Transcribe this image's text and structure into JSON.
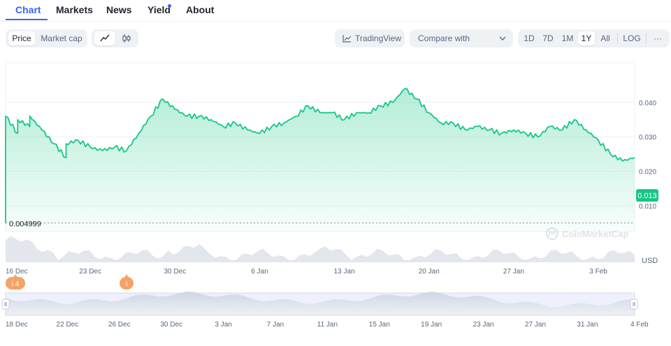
{
  "tabs": [
    {
      "label": "Chart",
      "active": true
    },
    {
      "label": "Markets"
    },
    {
      "label": "News"
    },
    {
      "label": "Yield",
      "has_dot": true
    },
    {
      "label": "About"
    }
  ],
  "toolbar": {
    "price_label": "Price",
    "market_cap_label": "Market cap",
    "line_icon": "line-chart-icon",
    "candle_icon": "candlestick-icon",
    "tradingview_label": "TradingView",
    "compare_label": "Compare with",
    "ranges": [
      "1D",
      "7D",
      "1M",
      "1Y",
      "All"
    ],
    "selected_range": "1Y",
    "log_label": "LOG",
    "more_label": "···"
  },
  "colors": {
    "accent": "#3861fb",
    "line": "#16c784",
    "fill": "#16c784",
    "marker": "#f5a266"
  },
  "chart_data": {
    "type": "area",
    "y_ticks": [
      "0.040",
      "0.030",
      "0.020",
      "0.010"
    ],
    "ylim": [
      0.0025,
      0.0515
    ],
    "currency": "USD",
    "current_price_label": "0.013",
    "low_label": "0.004999",
    "x_tick_labels": [
      "16 Dec",
      "23 Dec",
      "30 Dec",
      "6 Jan",
      "13 Jan",
      "20 Jan",
      "27 Jan",
      "3 Feb"
    ],
    "x_tick_dates": [
      "2024-12-16",
      "2024-12-23",
      "2024-12-30",
      "2025-01-06",
      "2025-01-13",
      "2025-01-20",
      "2025-01-27",
      "2025-02-03"
    ],
    "x_range": [
      "2024-12-16",
      "2025-02-06"
    ],
    "points": [
      [
        "2024-12-16",
        0.005
      ],
      [
        "2024-12-16",
        0.036
      ],
      [
        "2024-12-17",
        0.031
      ],
      [
        "2024-12-17",
        0.035
      ],
      [
        "2024-12-18",
        0.033
      ],
      [
        "2024-12-18",
        0.036
      ],
      [
        "2024-12-19",
        0.032
      ],
      [
        "2024-12-20",
        0.028
      ],
      [
        "2024-12-21",
        0.024
      ],
      [
        "2024-12-21",
        0.028
      ],
      [
        "2024-12-22",
        0.029
      ],
      [
        "2024-12-23",
        0.027
      ],
      [
        "2024-12-24",
        0.026
      ],
      [
        "2024-12-25",
        0.027
      ],
      [
        "2024-12-26",
        0.026
      ],
      [
        "2024-12-27",
        0.031
      ],
      [
        "2024-12-28",
        0.036
      ],
      [
        "2024-12-29",
        0.041
      ],
      [
        "2024-12-30",
        0.038
      ],
      [
        "2024-12-31",
        0.036
      ],
      [
        "2025-01-01",
        0.036
      ],
      [
        "2025-01-02",
        0.035
      ],
      [
        "2025-01-03",
        0.033
      ],
      [
        "2025-01-04",
        0.034
      ],
      [
        "2025-01-05",
        0.032
      ],
      [
        "2025-01-06",
        0.031
      ],
      [
        "2025-01-07",
        0.033
      ],
      [
        "2025-01-08",
        0.034
      ],
      [
        "2025-01-09",
        0.036
      ],
      [
        "2025-01-10",
        0.039
      ],
      [
        "2025-01-11",
        0.037
      ],
      [
        "2025-01-12",
        0.037
      ],
      [
        "2025-01-13",
        0.035
      ],
      [
        "2025-01-14",
        0.037
      ],
      [
        "2025-01-15",
        0.037
      ],
      [
        "2025-01-16",
        0.039
      ],
      [
        "2025-01-17",
        0.04
      ],
      [
        "2025-01-18",
        0.044
      ],
      [
        "2025-01-19",
        0.041
      ],
      [
        "2025-01-20",
        0.037
      ],
      [
        "2025-01-21",
        0.034
      ],
      [
        "2025-01-22",
        0.034
      ],
      [
        "2025-01-23",
        0.032
      ],
      [
        "2025-01-24",
        0.033
      ],
      [
        "2025-01-25",
        0.032
      ],
      [
        "2025-01-26",
        0.031
      ],
      [
        "2025-01-27",
        0.032
      ],
      [
        "2025-01-28",
        0.031
      ],
      [
        "2025-01-29",
        0.03
      ],
      [
        "2025-01-30",
        0.033
      ],
      [
        "2025-01-31",
        0.032
      ],
      [
        "2025-02-01",
        0.035
      ],
      [
        "2025-02-02",
        0.032
      ],
      [
        "2025-02-03",
        0.029
      ],
      [
        "2025-02-04",
        0.025
      ],
      [
        "2025-02-05",
        0.023
      ],
      [
        "2025-02-06",
        0.024
      ]
    ],
    "markers": [
      {
        "date": "2024-12-16",
        "label": "i 4"
      },
      {
        "date": "2024-12-26",
        "label": "i"
      }
    ],
    "navigator_labels": [
      "18 Dec",
      "22 Dec",
      "26 Dec",
      "30 Dec",
      "3 Jan",
      "7 Jan",
      "11 Jan",
      "15 Jan",
      "19 Jan",
      "23 Jan",
      "27 Jan",
      "31 Jan",
      "4 Feb"
    ],
    "watermark": "CoinMarketCap"
  }
}
